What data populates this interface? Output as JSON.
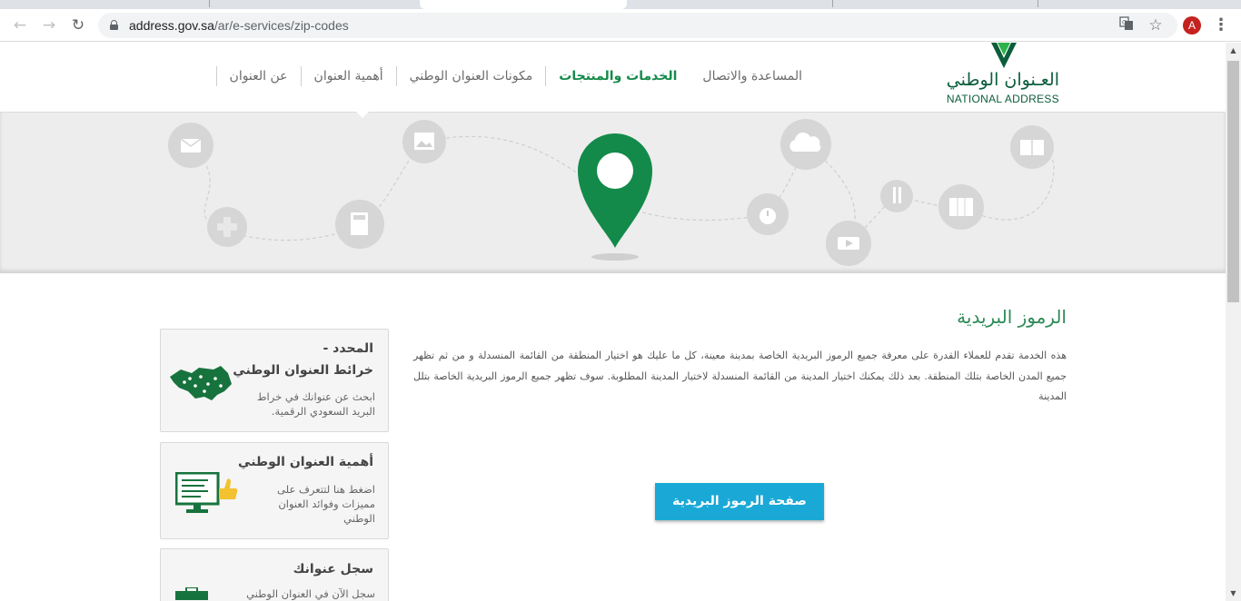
{
  "browser": {
    "url_domain": "address.gov.sa",
    "url_path": "/ar/e-services/zip-codes",
    "profile_initial": "A"
  },
  "site": {
    "logo_ar": "العـنوان الوطني",
    "logo_en": "NATIONAL ADDRESS",
    "nav": [
      {
        "label": "عن العنوان",
        "active": false
      },
      {
        "label": "أهمية العنوان",
        "active": false
      },
      {
        "label": "مكونات العنوان الوطني",
        "active": false
      },
      {
        "label": "الخدمات والمنتجات",
        "active": true
      },
      {
        "label": "المساعدة والاتصال",
        "active": false
      }
    ]
  },
  "content": {
    "title": "الرموز البريدية",
    "description": "هذه الخدمة تقدم للعملاء القدرة على معرفة جميع الرموز البريدية الخاصة بمدينة معينة، كل ما عليك هو اختيار المنطقة من القائمة المنسدلة و من ثم تظهر جميع المدن الخاصة بتلك المنطقة. بعد ذلك يمكنك اختيار المدينة من القائمة المنسدلة لاختيار المدينة المطلوبة. سوف تظهر جميع الرموز البريدية الخاصة بتلل المدينة",
    "button_label": "صفحة الرموز البريدية"
  },
  "sidebar": {
    "cards": [
      {
        "title_line1": "المحدد -",
        "title_line2": "خرائط العنوان الوطني",
        "desc_line1": "ابحث عن عنوانك في خراط",
        "desc_line2": "البريد السعودي الرقمية."
      },
      {
        "title": "أهمية العنوان الوطني",
        "desc_line1": "اضغط هنا لتتعرف على",
        "desc_line2": "مميزات وفوائد العنوان",
        "desc_line3": "الوطني"
      },
      {
        "title": "سجل عنوانك",
        "desc_line1": "سجل الآن في العنوان الوطني"
      }
    ]
  },
  "colors": {
    "brand_green": "#138a4a",
    "button_blue": "#1aa9d7",
    "title_green": "#2e8b57"
  }
}
